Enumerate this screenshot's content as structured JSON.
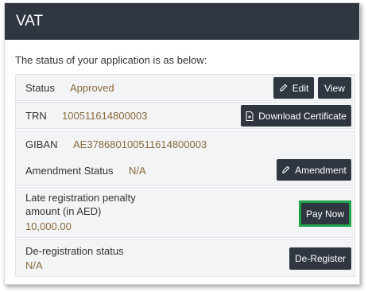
{
  "header": {
    "title": "VAT"
  },
  "intro_text": "The status of your application is as below:",
  "status_row": {
    "label": "Status",
    "value": "Approved",
    "edit_label": "Edit",
    "view_label": "View"
  },
  "trn_row": {
    "label": "TRN",
    "value": "100511614800003",
    "download_label": "Download Certificate"
  },
  "giban_row": {
    "label": "GIBAN",
    "value": "AE378680100511614800003"
  },
  "amendment_row": {
    "label": "Amendment Status",
    "value": "N/A",
    "button_label": "Amendment"
  },
  "penalty_row": {
    "label_line1": "Late registration penalty",
    "label_line2": "amount (in AED)",
    "value": "10,000.00",
    "button_label": "Pay Now"
  },
  "dereg_row": {
    "label": "De-registration status",
    "value": "N/A",
    "button_label": "De-Register"
  },
  "colors": {
    "header_bg": "#2f3640",
    "button_bg": "#2f3640",
    "value_text": "#8a6a3a",
    "pay_highlight": "#1fa34a",
    "row_bg": "#f3f4f6"
  },
  "icons": {
    "edit": "pencil-icon",
    "download": "document-icon",
    "amendment": "pencil-icon"
  }
}
